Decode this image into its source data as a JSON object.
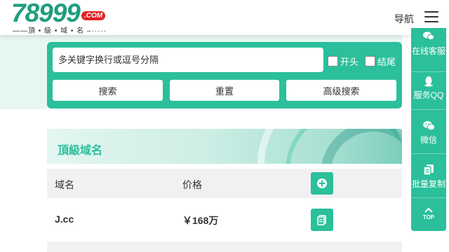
{
  "logo": {
    "brand_number": "78999",
    "brand_suffix": ".COM",
    "tagline": "——頂 • 級 • 域 • 名 –·····"
  },
  "header": {
    "nav_label": "导航",
    "menu_icon": "hamburger-menu-icon"
  },
  "search": {
    "placeholder": "多关键字换行或逗号分隔",
    "value": "",
    "checkbox_start_label": "开头",
    "checkbox_end_label": "结尾",
    "checkbox_start_checked": false,
    "checkbox_end_checked": false,
    "search_button": "搜索",
    "reset_button": "重置",
    "advanced_button": "高级搜索"
  },
  "section": {
    "title": "頂級域名"
  },
  "table": {
    "headers": [
      "域名",
      "价格",
      ""
    ],
    "header_action_icon": "plus-circle-icon",
    "rows": [
      {
        "domain": "J.cc",
        "price": "￥168万",
        "action_icon": "copy-icon"
      }
    ]
  },
  "sidebar": {
    "items": [
      {
        "label": "在线客服",
        "icon": "chat-bubble-icon"
      },
      {
        "label": "服务QQ",
        "icon": "qq-penguin-icon"
      },
      {
        "label": "微信",
        "icon": "wechat-icon"
      },
      {
        "label": "批量复制",
        "icon": "copy-icon"
      },
      {
        "label": "TOP",
        "icon": "chevron-up-icon"
      }
    ]
  },
  "colors": {
    "accent": "#2bbf9b",
    "brand_green": "#1f9e7e",
    "brand_red": "#e02424",
    "light_tint": "#e6f6f1",
    "table_stripe": "#f1f1f1"
  }
}
